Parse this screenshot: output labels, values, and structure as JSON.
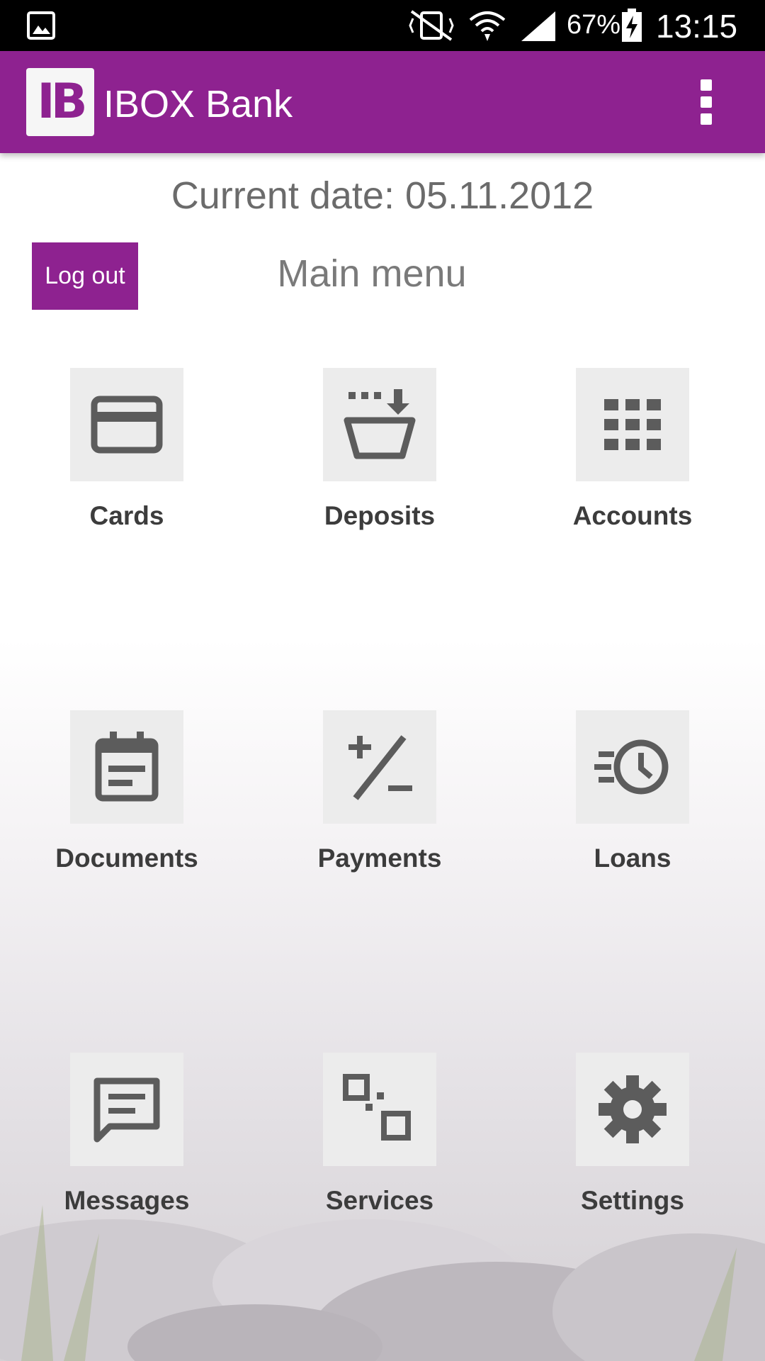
{
  "status_bar": {
    "battery_percent": "67%",
    "time": "13:15",
    "icons": [
      "image-icon",
      "vibrate-mute-icon",
      "wifi-icon",
      "signal-icon",
      "battery-charging-icon"
    ]
  },
  "app_bar": {
    "logo_text": "IB",
    "title": "IBOX Bank",
    "overflow_icon": "more-vert-icon"
  },
  "header": {
    "current_date": "Current date: 05.11.2012",
    "logout_label": "Log out",
    "menu_title": "Main menu"
  },
  "menu": {
    "items": [
      {
        "label": "Cards",
        "icon": "credit-card-icon"
      },
      {
        "label": "Deposits",
        "icon": "deposit-basket-icon"
      },
      {
        "label": "Accounts",
        "icon": "grid-icon"
      },
      {
        "label": "Documents",
        "icon": "calendar-document-icon"
      },
      {
        "label": "Payments",
        "icon": "plus-minus-icon"
      },
      {
        "label": "Loans",
        "icon": "clock-history-icon"
      },
      {
        "label": "Messages",
        "icon": "chat-message-icon"
      },
      {
        "label": "Services",
        "icon": "services-squares-icon"
      },
      {
        "label": "Settings",
        "icon": "gear-icon"
      }
    ]
  },
  "colors": {
    "brand": "#8e2290",
    "tile_bg": "#ececec",
    "icon_gray": "#5c5c5c",
    "label_text": "#3c3c3c"
  }
}
